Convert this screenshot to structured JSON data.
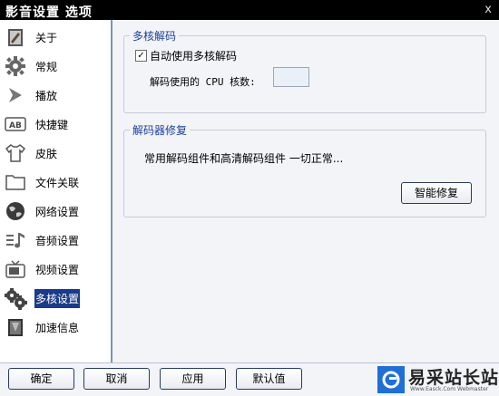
{
  "window": {
    "title": "影音设置 选项",
    "close_glyph": "x"
  },
  "sidebar": {
    "items": [
      {
        "label": "关于",
        "icon": "about-book-icon",
        "selected": false
      },
      {
        "label": "常规",
        "icon": "gear-icon",
        "selected": false
      },
      {
        "label": "播放",
        "icon": "play-arrow-icon",
        "selected": false
      },
      {
        "label": "快捷键",
        "icon": "ab-keyboard-icon",
        "selected": false
      },
      {
        "label": "皮肤",
        "icon": "shirt-icon",
        "selected": false
      },
      {
        "label": "文件关联",
        "icon": "folder-icon",
        "selected": false
      },
      {
        "label": "网络设置",
        "icon": "globe-icon",
        "selected": false
      },
      {
        "label": "音频设置",
        "icon": "music-icon",
        "selected": false
      },
      {
        "label": "视频设置",
        "icon": "tv-icon",
        "selected": false
      },
      {
        "label": "多核设置",
        "icon": "cpu-gears-icon",
        "selected": true
      },
      {
        "label": "加速信息",
        "icon": "accel-book-icon",
        "selected": false
      }
    ]
  },
  "multicore": {
    "group_title": "多核解码",
    "checkbox_label": "自动使用多核解码",
    "checkbox_checked": true,
    "checkbox_mark": "✓",
    "cores_label": "解码使用的 CPU 核数:",
    "cores_value": ""
  },
  "repair": {
    "group_title": "解码器修复",
    "status_text": "常用解码组件和高清解码组件 一切正常...",
    "button_label": "智能修复"
  },
  "footer": {
    "ok_label": "确定",
    "cancel_label": "取消",
    "apply_label": "应用",
    "default_label": "默认值"
  },
  "watermark": {
    "text": "易采站长站",
    "subtext": "Www.Easck.Com Webmaster"
  },
  "colors": {
    "accent": "#1a3a8a",
    "group_title": "#1b3f9a",
    "selection": "#1a3a8a"
  }
}
